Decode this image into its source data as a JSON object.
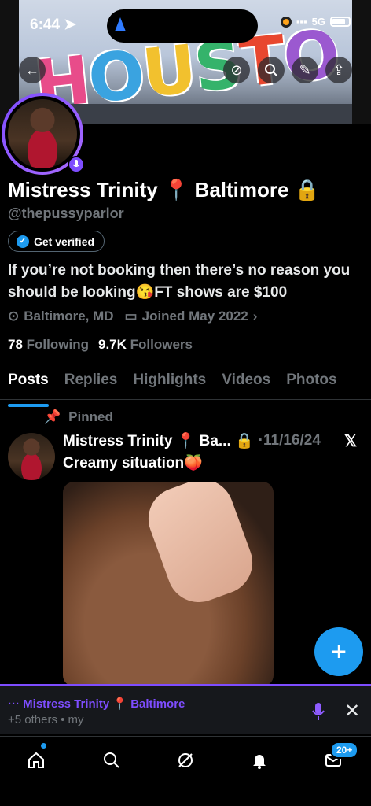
{
  "status_bar": {
    "time": "6:44",
    "network": "5G"
  },
  "banner": {
    "sign_text": "HOUSTON"
  },
  "profile": {
    "name": "Mistress Trinity 📍 Baltimore 🔒",
    "handle": "@thepussyparlor",
    "verify_label": "Get verified",
    "bio": "If you’re not booking then there’s no reason you should be looking😘FT shows are $100",
    "location": "Baltimore, MD",
    "joined": "Joined May 2022",
    "following_count": "78",
    "following_label": "Following",
    "followers_count": "9.7K",
    "followers_label": "Followers"
  },
  "tabs": [
    {
      "label": "Posts",
      "active": true
    },
    {
      "label": "Replies",
      "active": false
    },
    {
      "label": "Highlights",
      "active": false
    },
    {
      "label": "Videos",
      "active": false
    },
    {
      "label": "Photos",
      "active": false
    }
  ],
  "post": {
    "pinned_label": "Pinned",
    "author": "Mistress Trinity 📍 Ba... 🔒",
    "date": "·11/16/24",
    "text": "Creamy situation🍑"
  },
  "space": {
    "title": "··· Mistress Trinity 📍 Baltimore",
    "subtitle": "+5 others • my"
  },
  "bottom_nav": {
    "messages_badge": "20+"
  },
  "colors": {
    "accent": "#1d9bf0",
    "spaces": "#7e4dff",
    "muted": "#71767b"
  }
}
